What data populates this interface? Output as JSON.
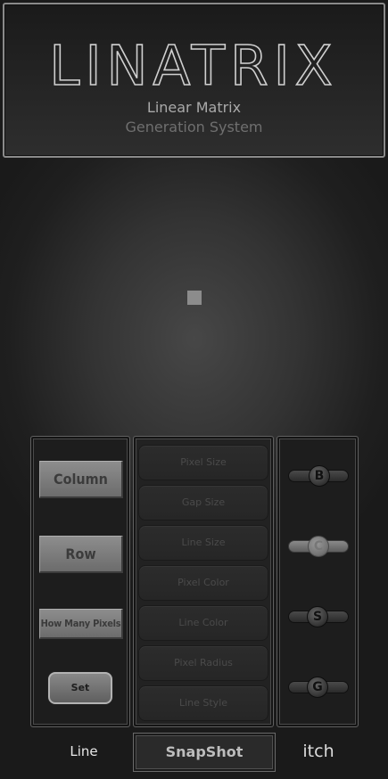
{
  "header": {
    "logo_text": "LINATRIX",
    "subtitle_line1": "Linear Matrix",
    "subtitle_line2": "Generation System"
  },
  "left_panel": {
    "column_label": "Column",
    "row_label": "Row",
    "how_many_label": "How Many Pixels",
    "set_label": "Set"
  },
  "settings_menu": {
    "items": [
      {
        "label": "Pixel Size"
      },
      {
        "label": "Gap Size"
      },
      {
        "label": "Line Size"
      },
      {
        "label": "Pixel Color"
      },
      {
        "label": "Line Color"
      },
      {
        "label": "Pixel Radius"
      },
      {
        "label": "Line Style"
      }
    ]
  },
  "sliders": {
    "items": [
      {
        "knob_label": "B"
      },
      {
        "knob_label": "C"
      },
      {
        "knob_label": "S"
      },
      {
        "knob_label": "G"
      }
    ]
  },
  "bottom_bar": {
    "line_label": "Line",
    "snapshot_label": "SnapShot",
    "itch_label": "itch"
  },
  "colors": {
    "background": "#1f1f1f",
    "accent_gray": "#8c8c8c"
  }
}
